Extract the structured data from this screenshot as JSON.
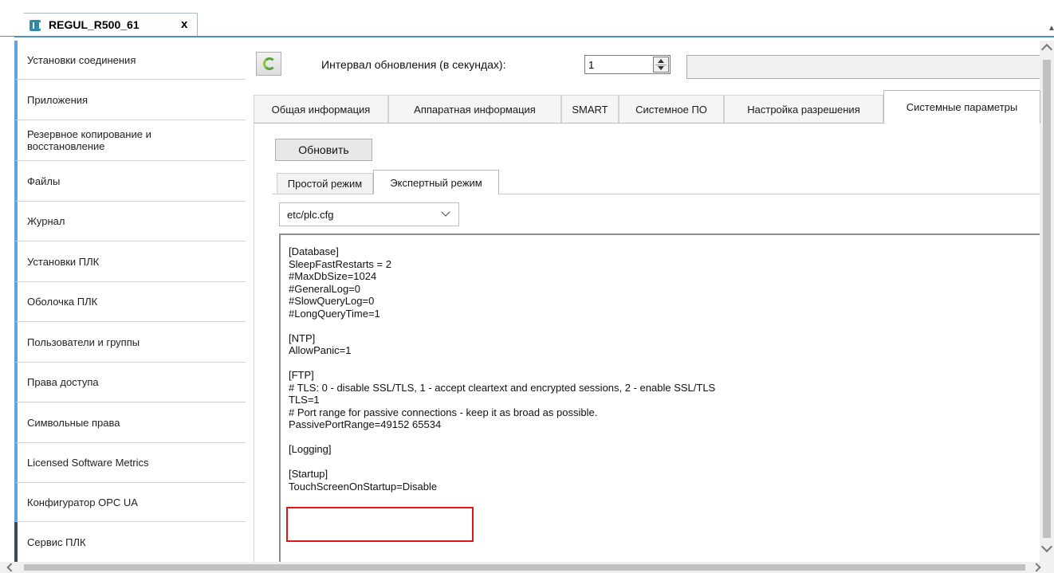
{
  "tab": {
    "title": "REGUL_R500_61",
    "icon": "plc-device-icon",
    "close": "x"
  },
  "sidebar": {
    "items": [
      {
        "label": "Установки соединения"
      },
      {
        "label": "Приложения"
      },
      {
        "label": "Резервное копирование и восстановление"
      },
      {
        "label": "Файлы"
      },
      {
        "label": "Журнал"
      },
      {
        "label": "Установки ПЛК"
      },
      {
        "label": "Оболочка ПЛК"
      },
      {
        "label": "Пользователи и группы"
      },
      {
        "label": "Права доступа"
      },
      {
        "label": "Символьные права"
      },
      {
        "label": "Licensed Software Metrics"
      },
      {
        "label": "Конфигуратор OPC UA"
      },
      {
        "label": "Сервис ПЛК"
      }
    ],
    "active_index": 12
  },
  "toolbar": {
    "refresh_icon": "refresh-icon",
    "interval_label": "Интервал обновления (в секундах):",
    "interval_value": "1"
  },
  "main_tabs": [
    {
      "label": "Общая информация"
    },
    {
      "label": "Аппаратная информация"
    },
    {
      "label": "SMART"
    },
    {
      "label": "Системное ПО"
    },
    {
      "label": "Настройка разрешения"
    },
    {
      "label": "Системные параметры"
    }
  ],
  "main_tabs_active": 5,
  "update_button": "Обновить",
  "sub_tabs": [
    {
      "label": "Простой режим"
    },
    {
      "label": "Экспертный режим"
    }
  ],
  "sub_tabs_active": 1,
  "file_select": {
    "value": "etc/plc.cfg"
  },
  "config": {
    "text": "[Database]\nSleepFastRestarts = 2\n#MaxDbSize=1024\n#GeneralLog=0\n#SlowQueryLog=0\n#LongQueryTime=1\n\n[NTP]\nAllowPanic=1\n\n[FTP]\n# TLS: 0 - disable SSL/TLS, 1 - accept cleartext and encrypted sessions, 2 - enable SSL/TLS\nTLS=1\n# Port range for passive connections - keep it as broad as possible.\nPassivePortRange=49152 65534\n\n[Logging]\n\n[Startup]\nTouchScreenOnStartup=Disable",
    "highlight_color": "#e01616"
  },
  "colors": {
    "accent": "#5ea3e8",
    "tab_underline": "#4a90d9"
  }
}
